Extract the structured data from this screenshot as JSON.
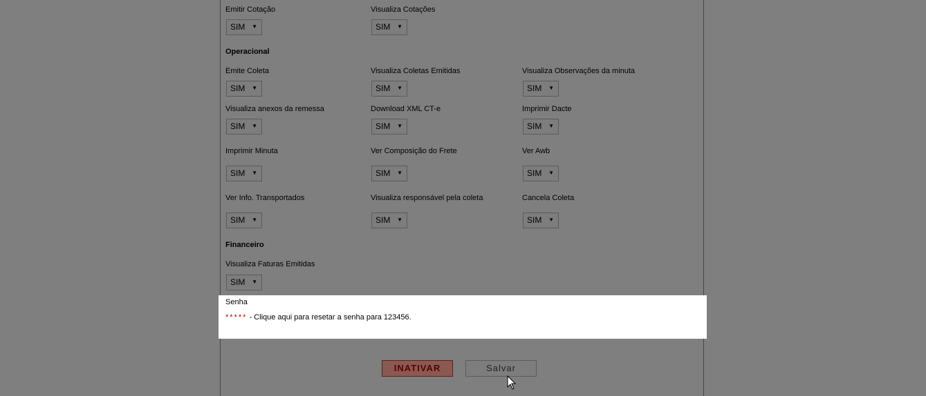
{
  "sections": {
    "operacional": "Operacional",
    "financeiro": "Financeiro"
  },
  "fields": {
    "emitir_cotacao": {
      "label": "Emitir Cotação",
      "value": "SIM"
    },
    "visualiza_cotacoes": {
      "label": "Visualiza Cotações",
      "value": "SIM"
    },
    "emite_coleta": {
      "label": "Emite Coleta",
      "value": "SIM"
    },
    "visualiza_coletas_emitidas": {
      "label": "Visualiza Coletas Emitidas",
      "value": "SIM"
    },
    "visualiza_observacoes_minuta": {
      "label": "Visualiza Observações da minuta",
      "value": "SIM"
    },
    "visualiza_anexos_remessa": {
      "label": "Visualiza anexos da remessa",
      "value": "SIM"
    },
    "download_xml_cte": {
      "label": "Download XML CT-e",
      "value": "SIM"
    },
    "imprimir_dacte": {
      "label": "Imprimir Dacte",
      "value": "SIM"
    },
    "imprimir_minuta": {
      "label": "Imprimir Minuta",
      "value": "SIM"
    },
    "ver_composicao_frete": {
      "label": "Ver Composição do Frete",
      "value": "SIM"
    },
    "ver_awb": {
      "label": "Ver Awb",
      "value": "SIM"
    },
    "ver_info_transportados": {
      "label": "Ver Info. Transportados",
      "value": "SIM"
    },
    "visualiza_responsavel_coleta": {
      "label": "Visualiza responsável pela coleta",
      "value": "SIM"
    },
    "cancela_coleta": {
      "label": "Cancela Coleta",
      "value": "SIM"
    },
    "visualiza_faturas_emitidas": {
      "label": "Visualiza Faturas Emitidas",
      "value": "SIM"
    }
  },
  "senha": {
    "title": "Senha",
    "stars": "*****",
    "reset_text": " - Clique aqui para resetar a senha para 123456."
  },
  "buttons": {
    "inativar": "INATIVAR",
    "salvar": "Salvar"
  },
  "icons": {
    "dropdown_arrow": "▼",
    "cursor": "arrow-pointer"
  },
  "colors": {
    "overlay": "#7f7f7f",
    "password_stars": "#b00000"
  }
}
